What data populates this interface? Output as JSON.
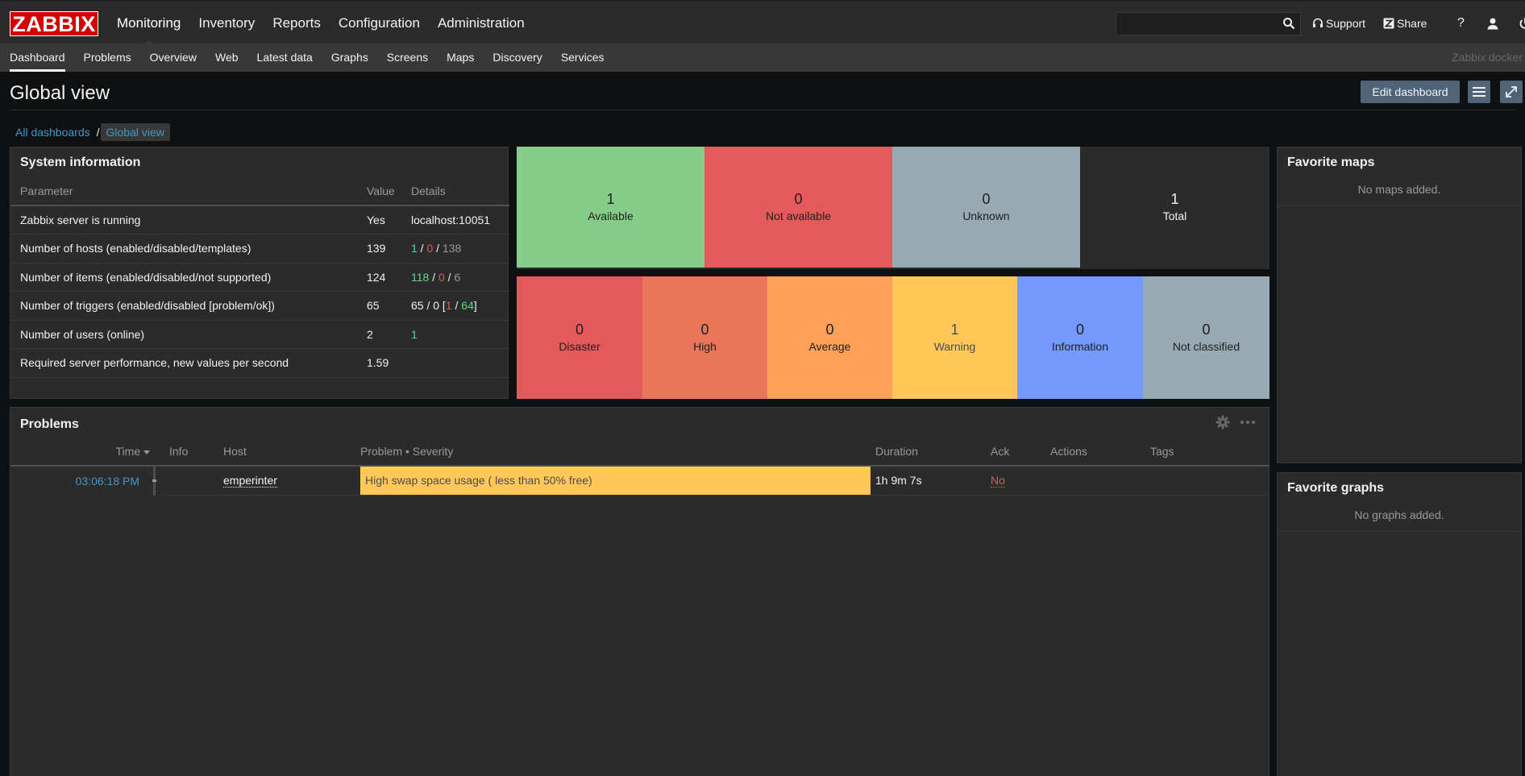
{
  "app": {
    "logo": "ZABBIX",
    "server_name": "Zabbix docker"
  },
  "main_menu": [
    {
      "label": "Monitoring",
      "active": true
    },
    {
      "label": "Inventory"
    },
    {
      "label": "Reports"
    },
    {
      "label": "Configuration"
    },
    {
      "label": "Administration"
    }
  ],
  "top_right": {
    "search_value": "",
    "support_label": "Support",
    "share_label": "Share",
    "help_label": "?"
  },
  "sub_menu": [
    {
      "label": "Dashboard",
      "active": true
    },
    {
      "label": "Problems"
    },
    {
      "label": "Overview"
    },
    {
      "label": "Web"
    },
    {
      "label": "Latest data"
    },
    {
      "label": "Graphs"
    },
    {
      "label": "Screens"
    },
    {
      "label": "Maps"
    },
    {
      "label": "Discovery"
    },
    {
      "label": "Services"
    }
  ],
  "header": {
    "title": "Global view",
    "edit_label": "Edit dashboard"
  },
  "breadcrumb": {
    "all": "All dashboards",
    "sep": "/",
    "current": "Global view"
  },
  "system_info": {
    "title": "System information",
    "columns": [
      "Parameter",
      "Value",
      "Details"
    ],
    "rows": [
      {
        "param": "Zabbix server is running",
        "value": "Yes",
        "details": "localhost:10051"
      },
      {
        "param": "Number of hosts (enabled/disabled/templates)",
        "value": "139",
        "d1": "1",
        "d2": "0",
        "d3": "138"
      },
      {
        "param": "Number of items (enabled/disabled/not supported)",
        "value": "124",
        "d1": "118",
        "d2": "0",
        "d3": "6"
      },
      {
        "param": "Number of triggers (enabled/disabled [problem/ok])",
        "value": "65",
        "d1": "65",
        "d2": "0",
        "d3": "1",
        "d4": "64"
      },
      {
        "param": "Number of users (online)",
        "value": "2",
        "d1": "1"
      },
      {
        "param": "Required server performance, new values per second",
        "value": "1.59",
        "details": ""
      }
    ]
  },
  "host_availability": [
    {
      "count": "1",
      "label": "Available",
      "color": "#86cc89"
    },
    {
      "count": "0",
      "label": "Not available",
      "color": "#e45959"
    },
    {
      "count": "0",
      "label": "Unknown",
      "color": "#97aab3"
    },
    {
      "count": "1",
      "label": "Total",
      "color": "#2b2b2b"
    }
  ],
  "problem_severities": [
    {
      "count": "0",
      "label": "Disaster",
      "color": "#e45959"
    },
    {
      "count": "0",
      "label": "High",
      "color": "#e97659"
    },
    {
      "count": "0",
      "label": "Average",
      "color": "#ffa059"
    },
    {
      "count": "1",
      "label": "Warning",
      "color": "#ffc859"
    },
    {
      "count": "0",
      "label": "Information",
      "color": "#7499ff"
    },
    {
      "count": "0",
      "label": "Not classified",
      "color": "#97aab3"
    }
  ],
  "problems": {
    "title": "Problems",
    "columns": {
      "time": "Time",
      "info": "Info",
      "host": "Host",
      "problem": "Problem • Severity",
      "duration": "Duration",
      "ack": "Ack",
      "actions": "Actions",
      "tags": "Tags"
    },
    "rows": [
      {
        "time": "03:06:18 PM",
        "host": "emperinter",
        "problem": "High swap space usage ( less than 50% free)",
        "duration": "1h 9m 7s",
        "ack": "No"
      }
    ]
  },
  "favorite_maps": {
    "title": "Favorite maps",
    "empty": "No maps added."
  },
  "favorite_graphs": {
    "title": "Favorite graphs",
    "empty": "No graphs added."
  }
}
